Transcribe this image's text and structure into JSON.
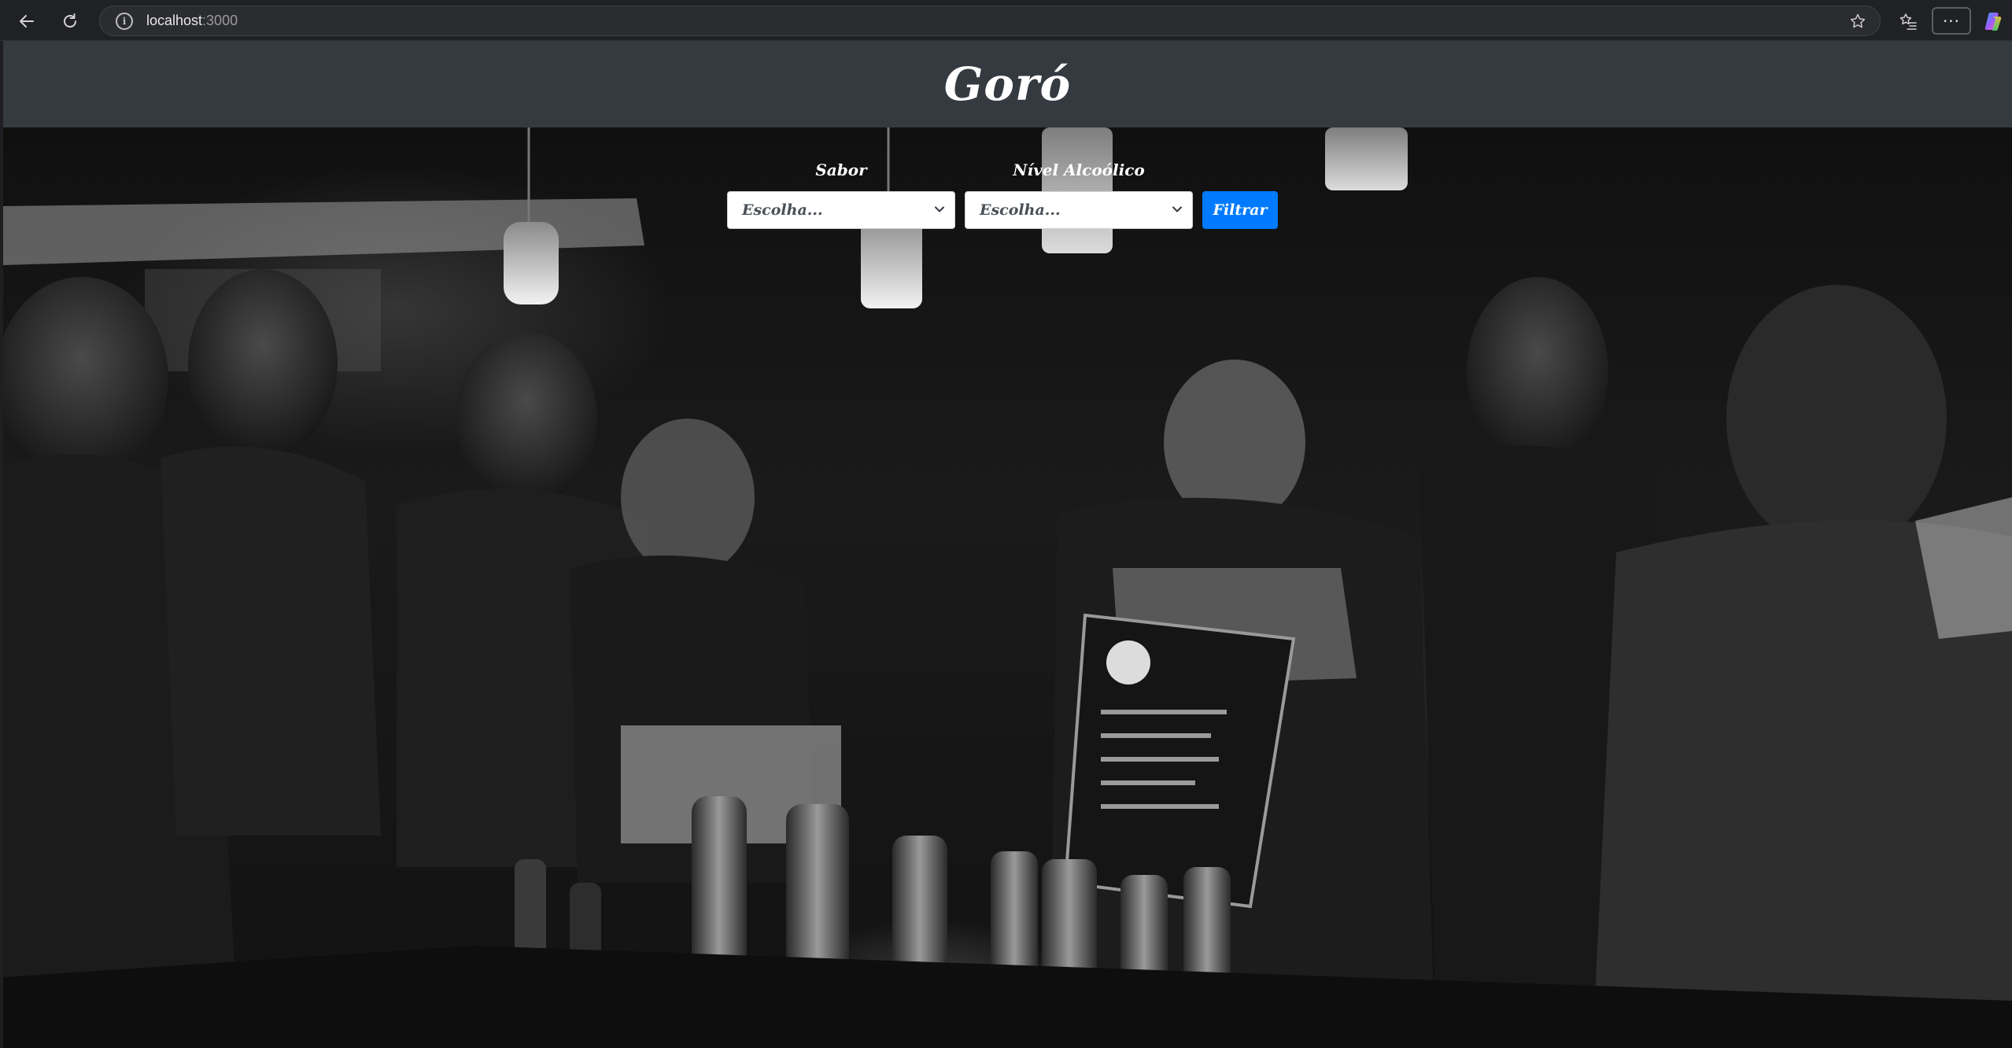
{
  "browser": {
    "url_host": "localhost",
    "url_port": ":3000",
    "more_label": "···"
  },
  "navbar": {
    "brand": "Goró"
  },
  "filters": {
    "sabor_label": "Sabor",
    "sabor_selected": "Escolha...",
    "nivel_label": "Nível Alcoólico",
    "nivel_selected": "Escolha...",
    "submit_label": "Filtrar"
  },
  "colors": {
    "navbar_bg": "#343a40",
    "button_primary": "#007bff"
  }
}
